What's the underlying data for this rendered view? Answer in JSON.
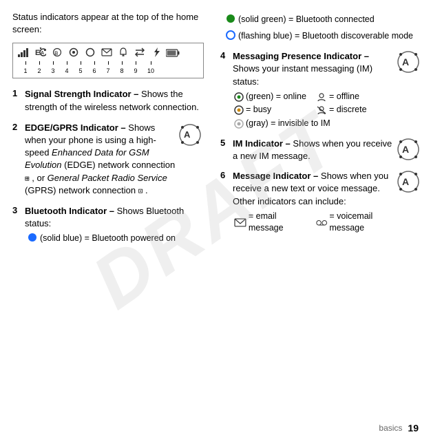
{
  "page": {
    "watermark": "DRAFT",
    "footer": {
      "section_label": "basics",
      "page_number": "19"
    }
  },
  "left_col": {
    "intro": "Status indicators appear at the top of the home screen:",
    "status_bar": {
      "icons": [
        "📶",
        "📡",
        "🔵",
        "☉",
        "○",
        "✉",
        "🔔",
        "↔",
        "⚡",
        "▬"
      ],
      "numbers": [
        "1",
        "2",
        "3",
        "4",
        "5",
        "6",
        "7",
        "8",
        "9",
        "10"
      ]
    },
    "items": [
      {
        "number": "1",
        "title": "Signal Strength Indicator",
        "dash": "–",
        "body": " Shows the strength of the wireless network connection."
      },
      {
        "number": "2",
        "title": "EDGE/GPRS Indicator",
        "dash": "–",
        "body_prefix": " Shows when your phone is using a high-speed ",
        "italic1": "Enhanced Data for GSM Evolution",
        "body2": " (EDGE) network connection ",
        "symbol1": "Ш",
        "body3": ", or ",
        "italic2": "General Packet Radio Service",
        "body4": " (GPRS) network connection ",
        "symbol2": "Ш",
        "body5": "."
      },
      {
        "number": "3",
        "title": "Bluetooth Indicator",
        "dash": "–",
        "body": " Shows Bluetooth status:",
        "sub_items": [
          {
            "icon": "🔵",
            "text": "(solid blue) = Bluetooth powered on"
          }
        ]
      }
    ]
  },
  "right_col": {
    "bluetooth_continued": [
      {
        "icon": "🔵",
        "text": "(solid green) = Bluetooth connected"
      },
      {
        "icon": "🔵",
        "text": "(flashing blue) = Bluetooth discoverable mode"
      }
    ],
    "items": [
      {
        "number": "4",
        "title": "Messaging Presence Indicator",
        "dash": "–",
        "body": " Shows your instant messaging (IM) status:",
        "status_grid": [
          {
            "icon": "☺",
            "text": "(green) = online"
          },
          {
            "icon": "👤",
            "text": "= offline"
          },
          {
            "icon": "☹",
            "text": "= busy"
          },
          {
            "icon": "💬",
            "text": "= discrete"
          },
          {
            "icon": "◌",
            "text": "(gray) = invisible to IM",
            "span": true
          }
        ]
      },
      {
        "number": "5",
        "title": "IM Indicator",
        "dash": "–",
        "body": " Shows when you receive a new IM message."
      },
      {
        "number": "6",
        "title": "Message Indicator",
        "dash": "–",
        "body": " Shows when you receive a new text or voice message. Other indicators can include:",
        "msg_grid": [
          {
            "icon": "✉",
            "text": "= email message"
          },
          {
            "icon": "📻",
            "text": "= voicemail message"
          }
        ]
      }
    ]
  }
}
